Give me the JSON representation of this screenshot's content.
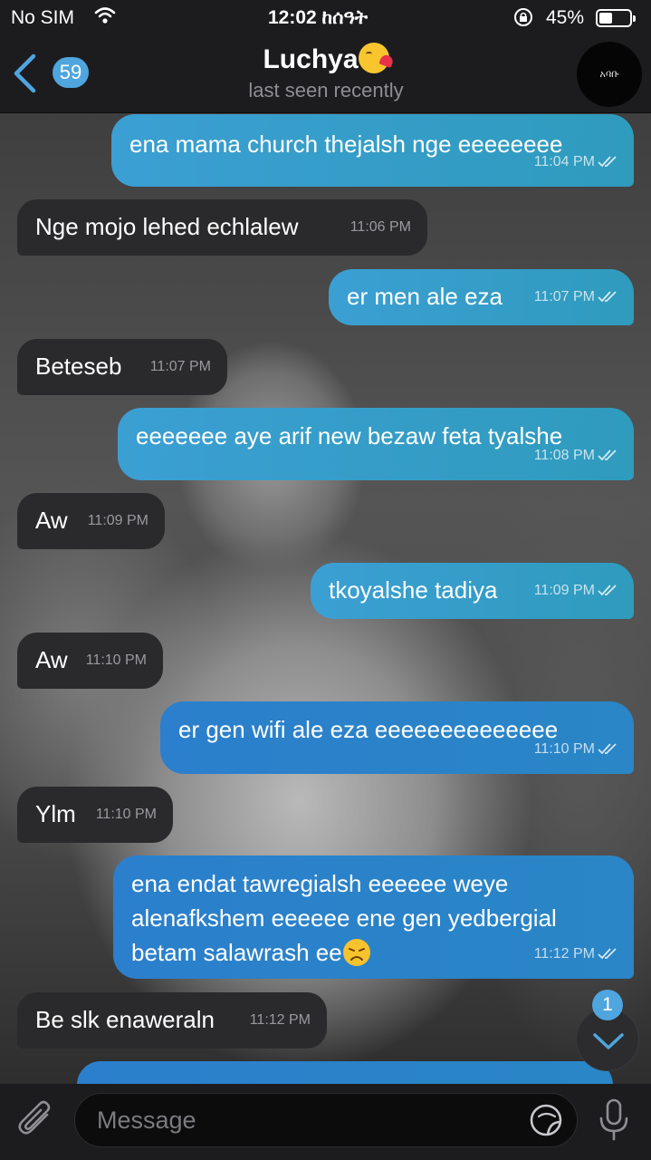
{
  "status_bar": {
    "carrier": "No SIM",
    "time": "12:02 ከሰዓት",
    "battery": "45%",
    "battery_level": 0.45
  },
  "header": {
    "back_count": "59",
    "contact_name": "Luchya",
    "status": "last seen recently",
    "avatar_text": "አባቡ"
  },
  "messages": [
    {
      "direction": "out",
      "text": "ena mama church thejalsh nge eeeeeeee",
      "time": "11:04 PM",
      "read": true
    },
    {
      "direction": "in",
      "text": "Nge mojo lehed echlalew",
      "time": "11:06 PM"
    },
    {
      "direction": "out",
      "text": "er men ale eza",
      "time": "11:07 PM",
      "read": true
    },
    {
      "direction": "in",
      "text": "Beteseb",
      "time": "11:07 PM"
    },
    {
      "direction": "out",
      "text": "eeeeeee aye arif new bezaw feta tyalshe",
      "time": "11:08 PM",
      "read": true
    },
    {
      "direction": "in",
      "text": "Aw",
      "time": "11:09 PM"
    },
    {
      "direction": "out",
      "text": "tkoyalshe tadiya",
      "time": "11:09 PM",
      "read": true
    },
    {
      "direction": "in",
      "text": "Aw",
      "time": "11:10 PM"
    },
    {
      "direction": "out",
      "text": "er gen wifi ale eza eeeeeeeeeeeeee",
      "time": "11:10 PM",
      "read": true
    },
    {
      "direction": "in",
      "text": "Ylm",
      "time": "11:10 PM"
    },
    {
      "direction": "out",
      "lines": [
        "ena endat tawregialsh eeeeee weye",
        "alenafkshem eeeeee ene gen yedbergial",
        "betam salawrash ee"
      ],
      "emoji": "disappointed-face",
      "time": "11:12 PM",
      "read": true
    },
    {
      "direction": "in",
      "text": "Be slk enaweraln",
      "time": "11:12 PM"
    }
  ],
  "scroll_down": {
    "unread": "1"
  },
  "input": {
    "placeholder": "Message"
  },
  "colors": {
    "accent": "#4fa5de",
    "outgoing_bubble": "#3b9fd3",
    "incoming_bubble": "#2a2a2c",
    "bar_background": "#1c1c1e"
  },
  "icons": [
    "wifi-icon",
    "lock-rotation-icon",
    "battery-icon",
    "back-chevron-icon",
    "kiss-emoji-icon",
    "double-check-icon",
    "chevron-down-icon",
    "paperclip-icon",
    "sticker-icon",
    "microphone-icon"
  ]
}
